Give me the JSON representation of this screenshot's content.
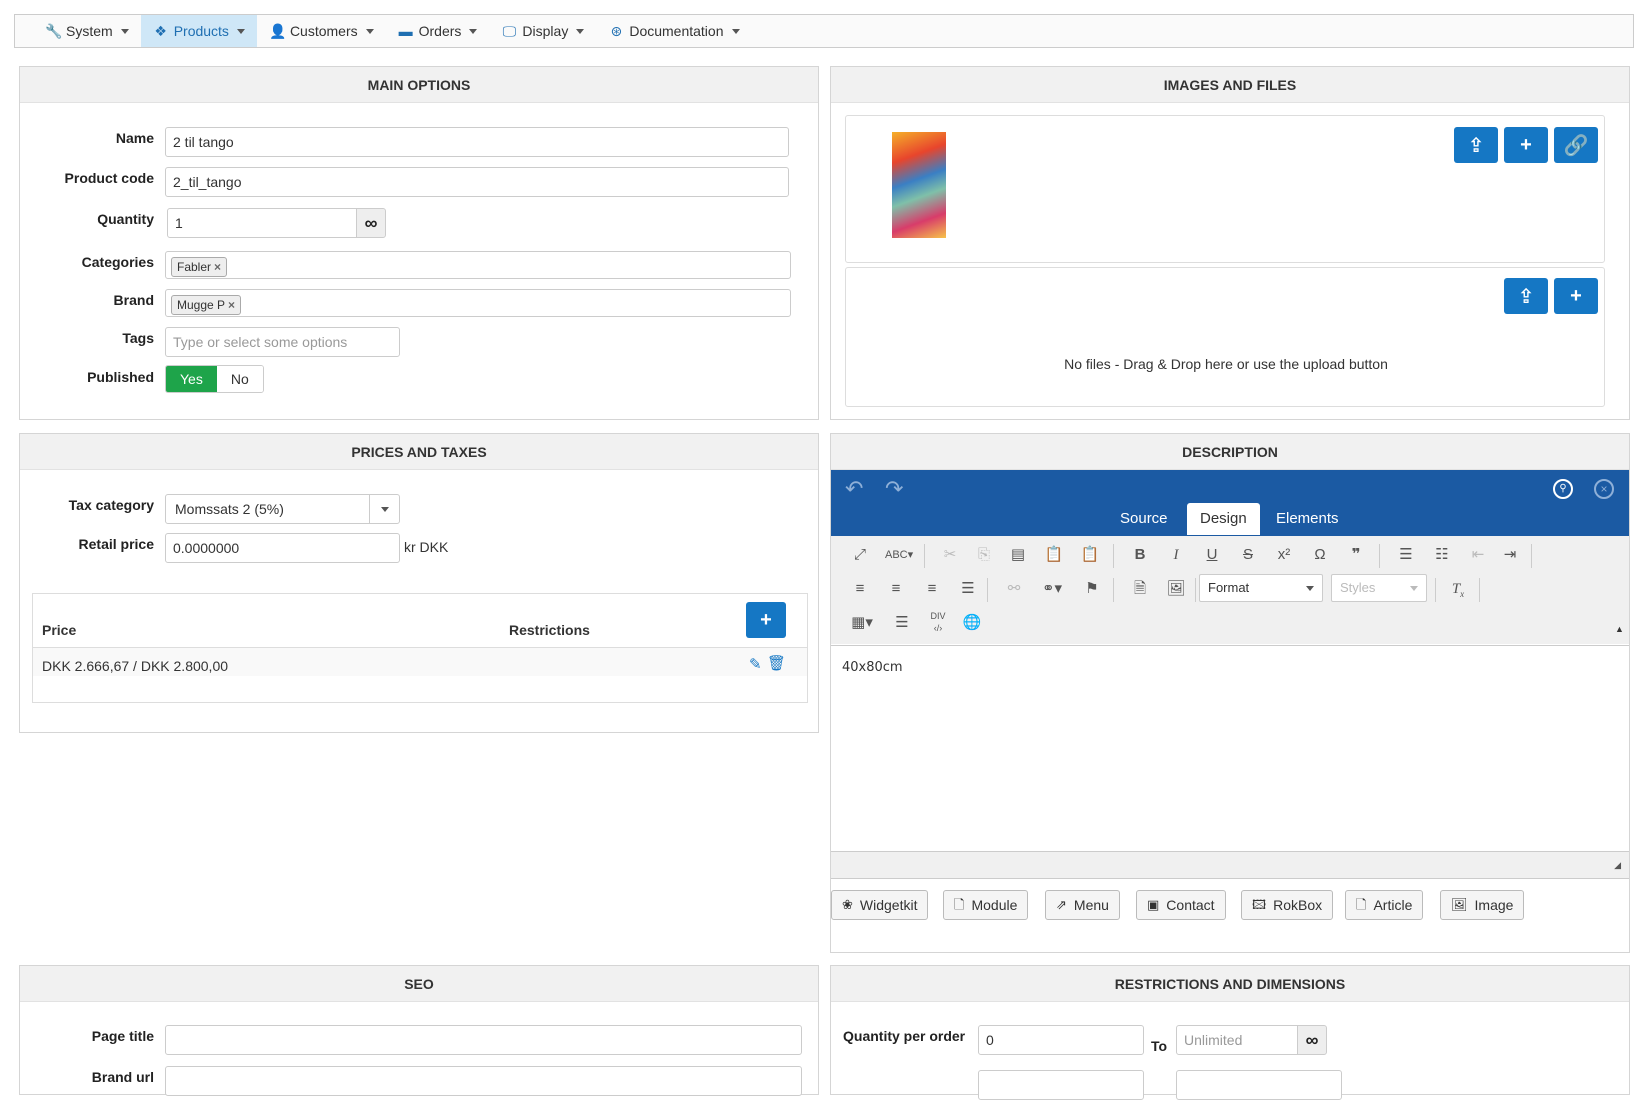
{
  "nav": {
    "items": [
      {
        "label": "System",
        "icon": "wrench-icon",
        "active": false
      },
      {
        "label": "Products",
        "icon": "cubes-icon",
        "active": true
      },
      {
        "label": "Customers",
        "icon": "user-icon",
        "active": false
      },
      {
        "label": "Orders",
        "icon": "credit-card-icon",
        "active": false
      },
      {
        "label": "Display",
        "icon": "monitor-icon",
        "active": false
      },
      {
        "label": "Documentation",
        "icon": "life-ring-icon",
        "active": false
      }
    ]
  },
  "main_options": {
    "title": "MAIN OPTIONS",
    "name_label": "Name",
    "name_value": "2 til tango",
    "code_label": "Product code",
    "code_value": "2_til_tango",
    "qty_label": "Quantity",
    "qty_value": "1",
    "categories_label": "Categories",
    "category_tag": "Fabler",
    "brand_label": "Brand",
    "brand_tag": "Mugge P",
    "tags_label": "Tags",
    "tags_placeholder": "Type or select some options",
    "published_label": "Published",
    "published_yes": "Yes",
    "published_no": "No"
  },
  "images": {
    "title": "IMAGES AND FILES",
    "no_files": "No files - Drag & Drop here or use the upload button"
  },
  "prices": {
    "title": "PRICES AND TAXES",
    "tax_label": "Tax category",
    "tax_value": "Momssats 2 (5%)",
    "retail_label": "Retail price",
    "retail_value": "0.0000000",
    "currency": "kr DKK",
    "col_price": "Price",
    "col_restrictions": "Restrictions",
    "row_price": "DKK 2.666,67 / DKK 2.800,00"
  },
  "description": {
    "title": "DESCRIPTION",
    "tabs": [
      "Source",
      "Design",
      "Elements"
    ],
    "active_tab": "Design",
    "format_label": "Format",
    "styles_label": "Styles",
    "content": "40x80cm",
    "ext_buttons": [
      "Widgetkit",
      "Module",
      "Menu",
      "Contact",
      "RokBox",
      "Article",
      "Image"
    ]
  },
  "seo": {
    "title": "SEO",
    "page_title_label": "Page title",
    "brand_url_label": "Brand url"
  },
  "restrictions": {
    "title": "RESTRICTIONS AND DIMENSIONS",
    "qty_label": "Quantity per order",
    "qty_from": "0",
    "to_label": "To",
    "qty_to_placeholder": "Unlimited"
  },
  "colors": {
    "accent": "#1577c4",
    "editor_bar": "#1b5aa3",
    "published_on": "#1ea44a"
  }
}
